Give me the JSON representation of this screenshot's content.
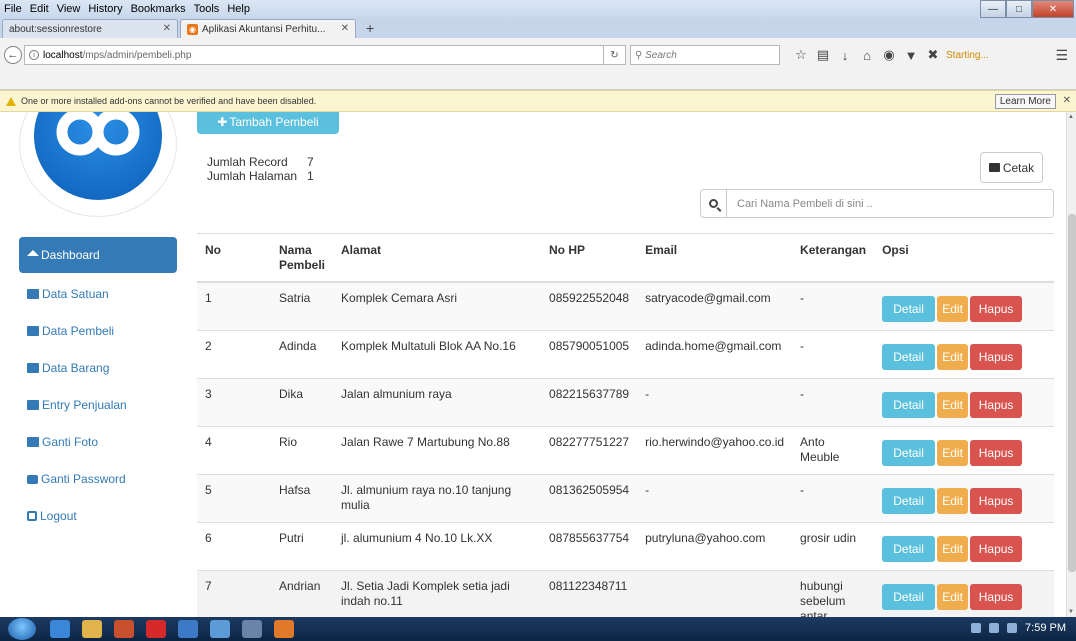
{
  "browser": {
    "menu": [
      "File",
      "Edit",
      "View",
      "History",
      "Bookmarks",
      "Tools",
      "Help"
    ],
    "tabs": [
      {
        "title": "about:sessionrestore",
        "active": false
      },
      {
        "title": "Aplikasi Akuntansi Perhitu...",
        "active": true
      }
    ],
    "url_host": "localhost",
    "url_path": "/mps/admin/pembeli.php",
    "search_placeholder": "Search",
    "status_text": "Starting...",
    "notice_text": "One or more installed add-ons cannot be verified and have been disabled.",
    "learn_more": "Learn More"
  },
  "sidebar": {
    "items": [
      {
        "label": "Dashboard",
        "icon": "home-icon",
        "active": true
      },
      {
        "label": "Data Satuan",
        "icon": "folder-icon",
        "active": false
      },
      {
        "label": "Data Pembeli",
        "icon": "folder-icon",
        "active": false
      },
      {
        "label": "Data Barang",
        "icon": "folder-icon",
        "active": false
      },
      {
        "label": "Entry Penjualan",
        "icon": "folder-icon",
        "active": false
      },
      {
        "label": "Ganti Foto",
        "icon": "picture-icon",
        "active": false
      },
      {
        "label": "Ganti Password",
        "icon": "lock-icon",
        "active": false
      },
      {
        "label": "Logout",
        "icon": "logout-icon",
        "active": false
      }
    ]
  },
  "main": {
    "add_button": "Tambah Pembeli",
    "record_label": "Jumlah Record",
    "record_value": "7",
    "page_label": "Jumlah Halaman",
    "page_value": "1",
    "print_button": "Cetak",
    "search_placeholder": "Cari Nama Pembeli di sini ..",
    "table": {
      "headers": [
        "No",
        "Nama Pembeli",
        "Alamat",
        "No HP",
        "Email",
        "Keterangan",
        "Opsi"
      ],
      "rows": [
        {
          "no": "1",
          "nama": "Satria",
          "alamat": "Komplek Cemara Asri",
          "hp": "085922552048",
          "email": "satryacode@gmail.com",
          "ket": "-"
        },
        {
          "no": "2",
          "nama": "Adinda",
          "alamat": "Komplek Multatuli Blok AA No.16",
          "hp": "085790051005",
          "email": "adinda.home@gmail.com",
          "ket": "-"
        },
        {
          "no": "3",
          "nama": "Dika",
          "alamat": "Jalan almunium raya",
          "hp": "082215637789",
          "email": "-",
          "ket": "-"
        },
        {
          "no": "4",
          "nama": "Rio",
          "alamat": "Jalan Rawe 7 Martubung No.88",
          "hp": "082277751227",
          "email": "rio.herwindo@yahoo.co.id",
          "ket": "Anto Meuble"
        },
        {
          "no": "5",
          "nama": "Hafsa",
          "alamat": "Jl. almunium raya no.10 tanjung mulia",
          "hp": "081362505954",
          "email": "-",
          "ket": "-"
        },
        {
          "no": "6",
          "nama": "Putri",
          "alamat": "jl. alumunium 4 No.10 Lk.XX",
          "hp": "087855637754",
          "email": "putryluna@yahoo.com",
          "ket": "grosir udin"
        },
        {
          "no": "7",
          "nama": "Andrian",
          "alamat": "Jl. Setia Jadi Komplek setia jadi indah no.11",
          "hp": "081122348711",
          "email": "",
          "ket": "hubungi sebelum antar"
        }
      ],
      "actions": {
        "detail": "Detail",
        "edit": "Edit",
        "hapus": "Hapus"
      }
    }
  },
  "taskbar": {
    "clock": "7:59 PM"
  },
  "colors": {
    "primary": "#337ab7",
    "info": "#5bc0de",
    "warning": "#f0ad4e",
    "danger": "#d9534f"
  }
}
